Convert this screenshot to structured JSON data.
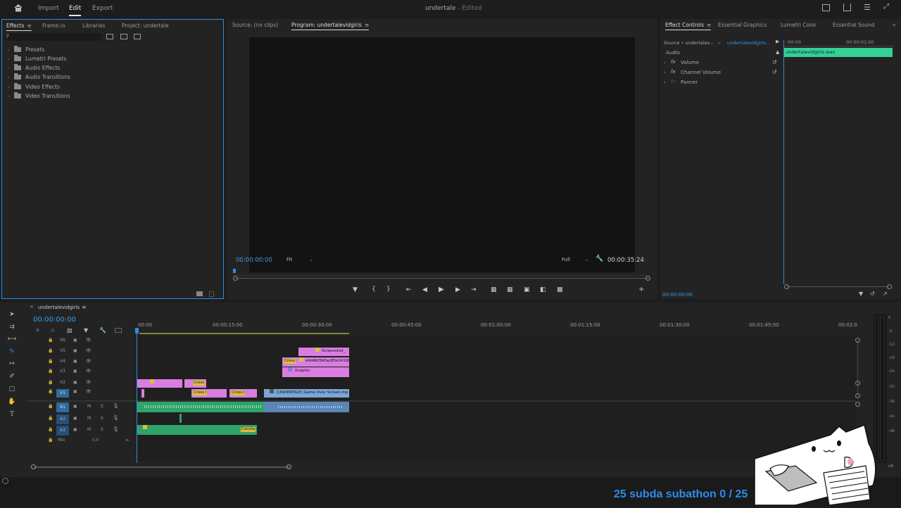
{
  "topbar": {
    "nav": [
      "Import",
      "Edit",
      "Export"
    ],
    "project_title": "undertale",
    "project_status": "- Edited"
  },
  "effects_panel": {
    "tabs": [
      "Effects",
      "Frame.io",
      "Libraries",
      "Project: undertale"
    ],
    "search_placeholder": "",
    "folders": [
      "Presets",
      "Lumetri Presets",
      "Audio Effects",
      "Audio Transitions",
      "Video Effects",
      "Video Transitions"
    ]
  },
  "monitor": {
    "tabs": [
      "Source: (no clips)",
      "Program: undertalevidgiris"
    ],
    "timecode": "00:00:00:00",
    "fit": "Fit",
    "quality": "Full",
    "duration": "00:00:35:24"
  },
  "effect_controls": {
    "tabs": [
      "Effect Controls",
      "Essential Graphics",
      "Lumetri Color",
      "Essential Sound"
    ],
    "source": "Source • undertalev...",
    "sequence": "undertalevidgiris...",
    "time_start": ":00:00",
    "time_end": "00:00:01:00",
    "section": "Audio",
    "effects": [
      "Volume",
      "Channel Volume",
      "Panner"
    ],
    "clip_name": "undertalevidgiris.wav",
    "timecode": "00:00:00:00"
  },
  "timeline": {
    "sequence_name": "undertalevidgiris",
    "timecode": "00:00:00:00",
    "ruler": [
      "00:00",
      "00:00:15:00",
      "00:00:30:00",
      "00:00:45:00",
      "00:01:00:00",
      "00:01:15:00",
      "00:01:30:00",
      "00:01:45:00",
      "00:02:0"
    ],
    "video_tracks": [
      "V6",
      "V5",
      "V4",
      "V3",
      "V2",
      "V1"
    ],
    "audio_tracks": [
      "A1",
      "A2",
      "A3"
    ],
    "mix_label": "Mix",
    "mix_value": "0,0",
    "clips": {
      "screenshot": "Screenshot_",
      "hash": "e4d4bf340ac85e14190",
      "graphic": "Graphic",
      "gameover": "[UNDERTALE] Game Over Screen.mp",
      "cross_v2": "Cross",
      "cross_v1": "Cross I",
      "cross_v1b": "Cross I",
      "cross_v4": "Cross",
      "const": "Consta"
    },
    "meter_ticks": [
      "0",
      "-6",
      "-12",
      "-18",
      "-24",
      "-30",
      "-36",
      "-42",
      "-48",
      "dB"
    ]
  },
  "overlay": {
    "subathon": "25 subda subathon 0 / 25"
  }
}
